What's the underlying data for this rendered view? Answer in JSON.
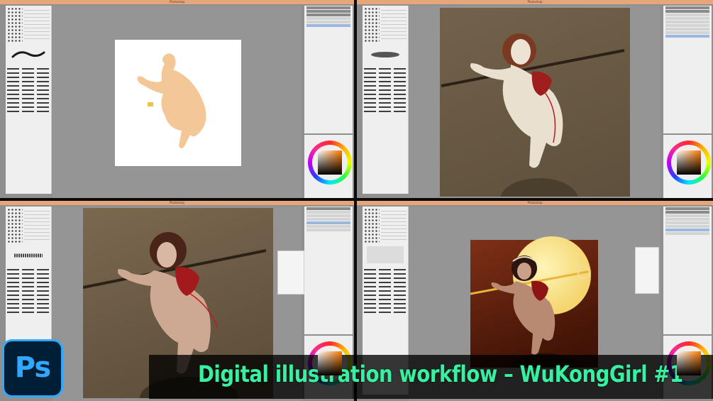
{
  "app": {
    "window_title": "Photoshop"
  },
  "panels": {
    "quadrants": [
      "step-1",
      "step-2",
      "step-3",
      "step-4"
    ]
  },
  "banner": {
    "title": "Digital illustration workflow – WuKongGirl #1"
  },
  "logo": {
    "text": "Ps",
    "brand_color": "#31a8ff",
    "bg_color": "#001e36"
  },
  "colors": {
    "accent_text": "#37f0a0",
    "titlebar": "#e7a67a"
  }
}
